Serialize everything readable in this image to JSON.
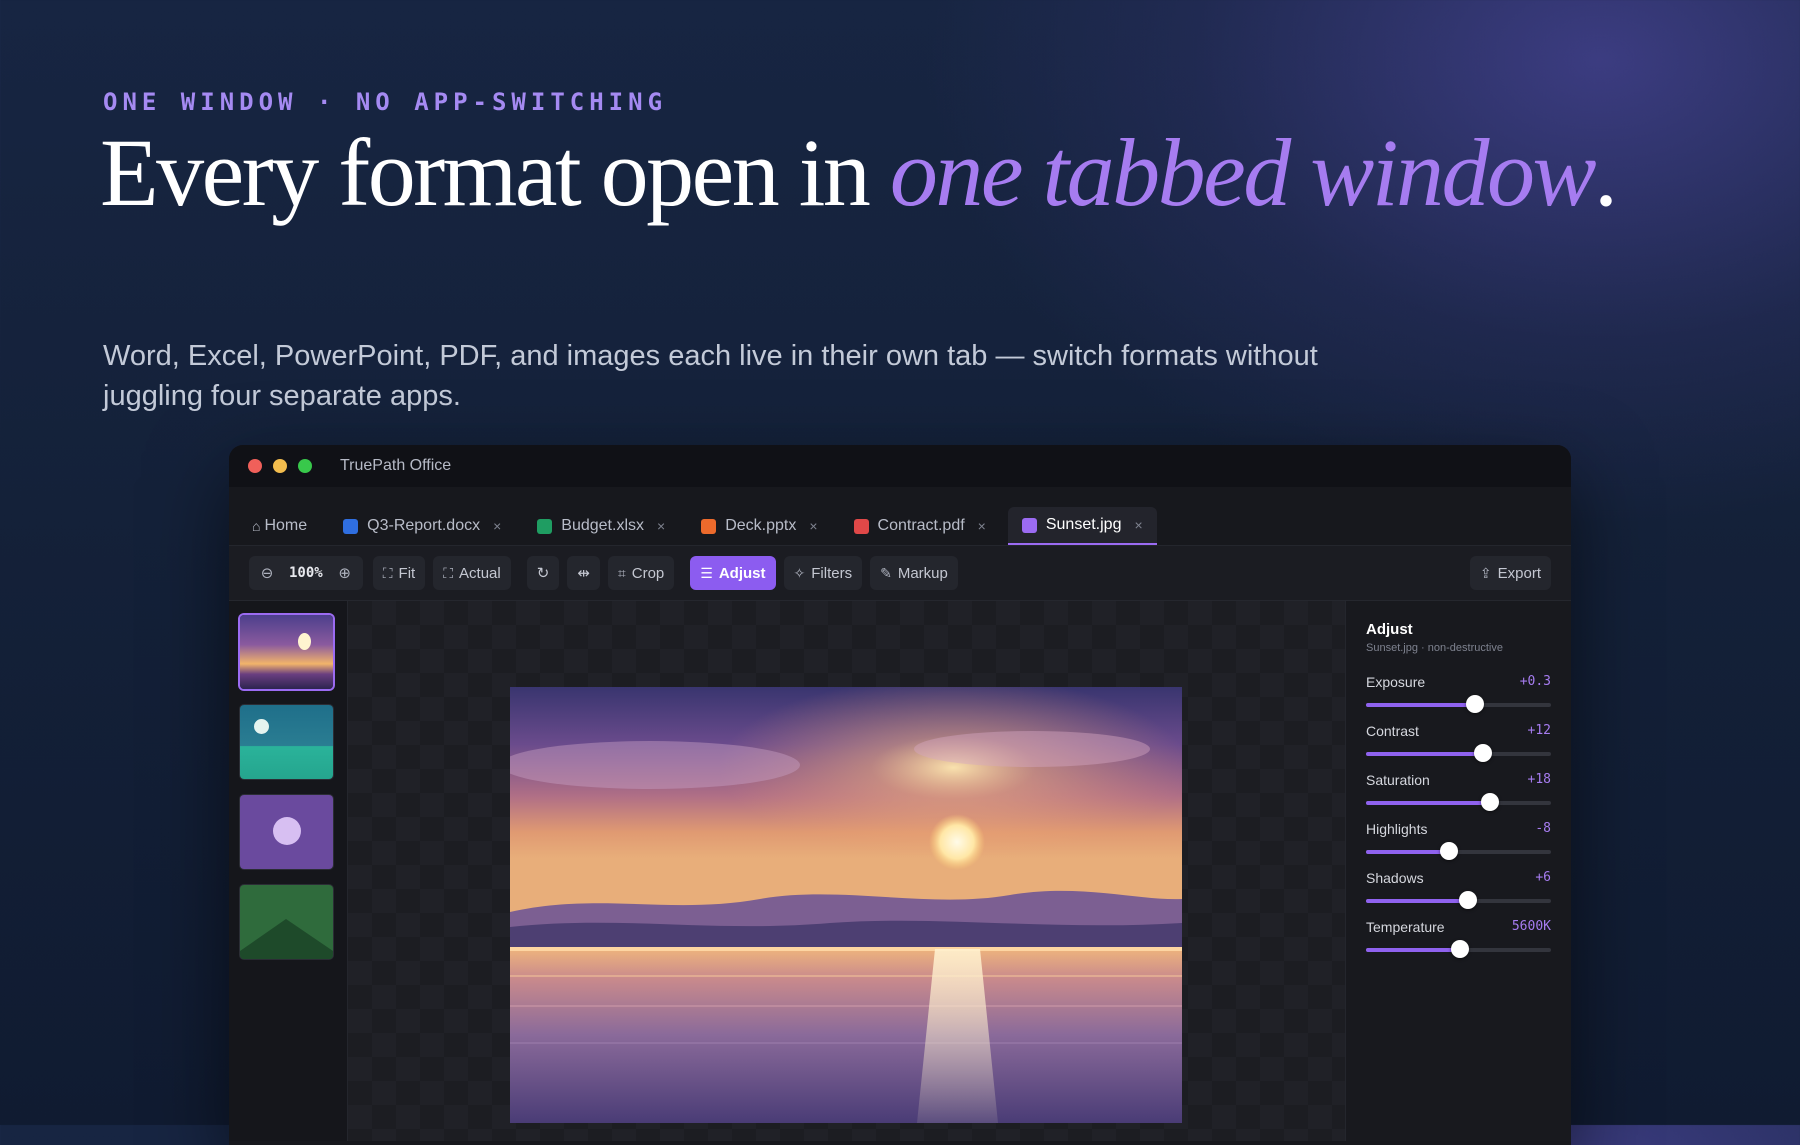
{
  "hero": {
    "eyebrow": "ONE WINDOW · NO APP-SWITCHING",
    "headline_plain": "Every format open in ",
    "headline_accent": "one tabbed window",
    "headline_end": ".",
    "subtitle": "Word, Excel, PowerPoint, PDF, and images each live in their own tab — switch formats without juggling four separate apps."
  },
  "window": {
    "title": "TruePath Office",
    "tabs": [
      {
        "label": "Home",
        "icon": "home-icon"
      },
      {
        "label": "Q3-Report.docx",
        "color": "#2f6ee0",
        "close": "×"
      },
      {
        "label": "Budget.xlsx",
        "color": "#1f9d62",
        "close": "×"
      },
      {
        "label": "Deck.pptx",
        "color": "#ec6a2c",
        "close": "×"
      },
      {
        "label": "Contract.pdf",
        "color": "#e04848",
        "close": "×"
      },
      {
        "label": "Sunset.jpg",
        "color": "#9b6bf2",
        "close": "×",
        "active": true
      }
    ],
    "toolbar": {
      "zoom": "100%",
      "fit": "Fit",
      "actual": "Actual",
      "crop": "Crop",
      "adjust": "Adjust",
      "filters": "Filters",
      "markup": "Markup",
      "export": "Export"
    },
    "panel": {
      "title": "Adjust",
      "subtitle": "Sunset.jpg · non-destructive",
      "sliders": [
        {
          "label": "Exposure",
          "value": "+0.3",
          "level": 0.59
        },
        {
          "label": "Contrast",
          "value": "+12",
          "level": 0.63
        },
        {
          "label": "Saturation",
          "value": "+18",
          "level": 0.67
        },
        {
          "label": "Highlights",
          "value": "-8",
          "level": 0.45
        },
        {
          "label": "Shadows",
          "value": "+6",
          "level": 0.55
        },
        {
          "label": "Temperature",
          "value": "5600K",
          "level": 0.51
        }
      ]
    },
    "colors": {
      "accent": "#9b6bf2",
      "headline_accent": "#a67cf0"
    }
  }
}
